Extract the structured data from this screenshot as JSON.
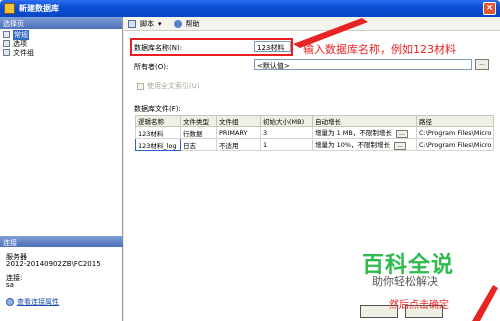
{
  "window": {
    "title": "新建数据库",
    "close_glyph": "×"
  },
  "left": {
    "header": "选择页",
    "nav_items": [
      {
        "label": "常规",
        "selected": true
      },
      {
        "label": "选项",
        "selected": false
      },
      {
        "label": "文件组",
        "selected": false
      }
    ],
    "connection_header": "连接",
    "server_label": "服务器",
    "server_value": "2012-20140902ZB\\FC2015",
    "connection_label": "连接:",
    "connection_value": "sa",
    "view_link": "查看连接属性"
  },
  "toolbar": {
    "script_label": "脚本",
    "script_dropdown": "▾",
    "help_label": "帮助"
  },
  "form": {
    "db_name_label": "数据库名称(N):",
    "db_name_value": "123材料",
    "owner_label": "所有者(O):",
    "owner_value": "<默认值>",
    "browse_glyph": "...",
    "fulltext_label": "使用全文索引(U)"
  },
  "files": {
    "section_label": "数据库文件(F):",
    "columns": [
      "逻辑名称",
      "文件类型",
      "文件组",
      "初始大小(MB)",
      "自动增长",
      "路径"
    ],
    "rows": [
      {
        "logical": "123材料",
        "type": "行数据",
        "group": "PRIMARY",
        "size": "3",
        "growth": "增量为 1 MB，不限制增长",
        "path": "C:\\Program Files\\Micro"
      },
      {
        "logical": "123材料_log",
        "type": "日志",
        "group": "不适用",
        "size": "1",
        "growth": "增量为 10%，不限制增长",
        "path": "C:\\Program Files\\Micro"
      }
    ]
  },
  "annotation": "输入数据库名称，例如123材料",
  "watermark": {
    "title": "百科全说",
    "subtitle": "助你轻松解决",
    "cta": "然后点击确定"
  },
  "colors": {
    "annotation_red": "#e62424",
    "watermark_green": "#2dbb4e",
    "title_blue": "#0a4fd6"
  }
}
